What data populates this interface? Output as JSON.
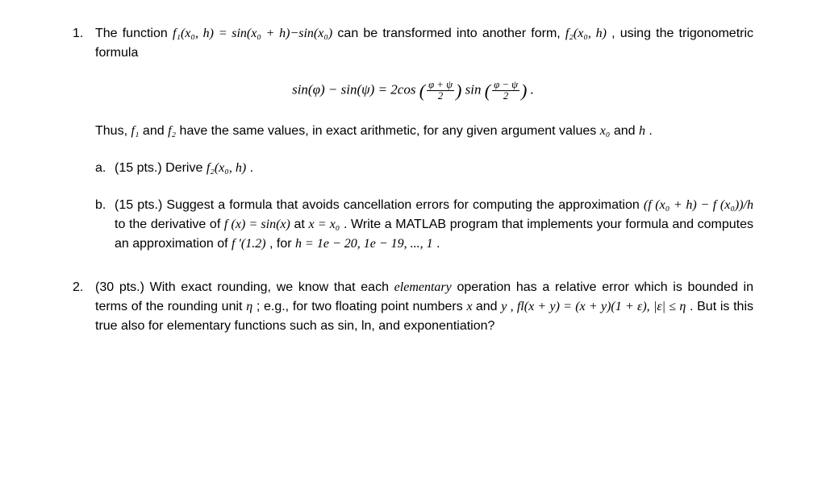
{
  "p1": {
    "number": "1.",
    "intro_a": "The  function ",
    "f1_def": "f₁(x₀, h)  =  sin(x₀ + h)−sin(x₀)",
    "intro_b": "  can  be  transformed  into  another  form, ",
    "f2_ref": "f₂(x₀, h)",
    "intro_c": " , using the trigonometric formula",
    "formula_lhs": "sin(φ) − sin(ψ)  =  2cos ",
    "frac1_num": "φ + ψ",
    "frac1_den": "2",
    "mid": "  sin ",
    "frac2_num": "φ − ψ",
    "frac2_den": "2",
    "formula_end": " .",
    "thus_a": "Thus,  ",
    "f1": "f₁",
    "thus_b": " and ",
    "f2": "f₂",
    "thus_c": " have the same values, in exact arithmetic, for any given argument values ",
    "x0": "x₀",
    "thus_d": " and ",
    "h": " h",
    "thus_e": " .",
    "parts": {
      "a": {
        "letter": "a.",
        "text_a": "(15 pts.) Derive ",
        "math": "f₂(x₀, h)",
        "text_b": " ."
      },
      "b": {
        "letter": "b.",
        "text_a": "(15 pts.) Suggest a formula that avoids cancellation errors for computing the approximation ",
        "math1": "(f (x₀  +  h) − f (x₀))/h",
        "text_b": " to   the   derivative   of ",
        "math2": "f (x)  =  sin(x)",
        "text_c": "   at   ",
        "math3": "x  =  x₀",
        "text_d": " .   Write   a   MATLAB program  that  implements  your  formula  and  computes  an  approximation  of ",
        "math4": "f ′(1.2)",
        "text_e": " ,   for ",
        "math5": "h  =  1e − 20, 1e − 19, ..., 1",
        "text_f": " ."
      }
    }
  },
  "p2": {
    "number": "2.",
    "text_a": "(30 pts.) With exact rounding, we know that each ",
    "elementary": "elementary",
    "text_b": " operation has a relative error which is bounded in terms of the rounding unit ",
    "eta": " η",
    "text_c": " ; e.g., for two floating point numbers ",
    "x": " x ",
    "text_d": " and ",
    "math1": "y , fl(x  +  y)  =  (x  +  y)(1 + ε),  |ε| ≤ η",
    "text_e": " . But is this true also for elementary functions such as sin, ln, and exponentiation?"
  }
}
